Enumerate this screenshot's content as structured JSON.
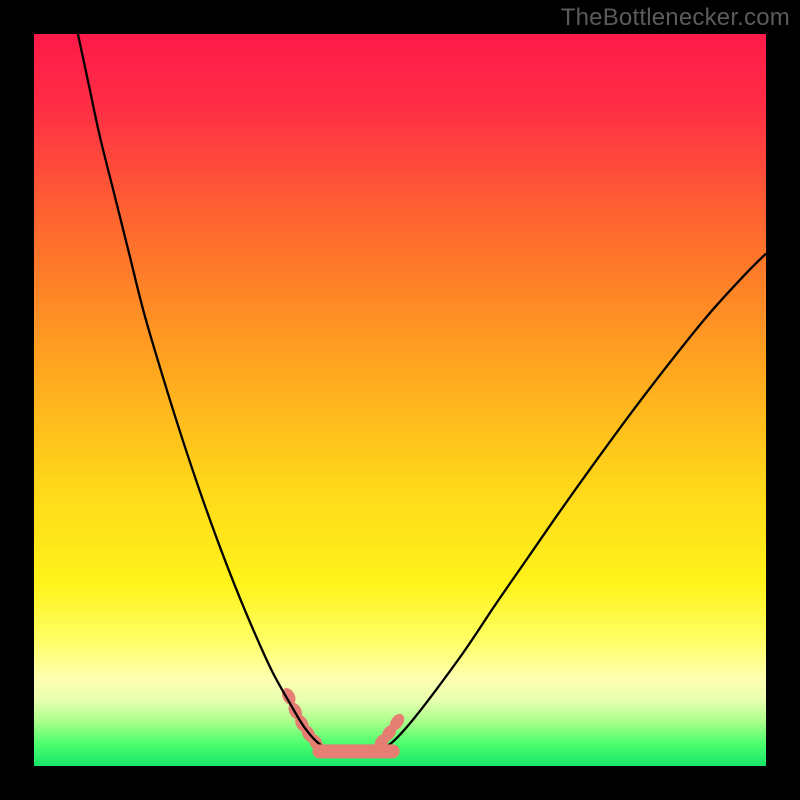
{
  "watermark": "TheBottlenecker.com",
  "chart_data": {
    "type": "line",
    "title": "",
    "xlabel": "",
    "ylabel": "",
    "xlim": [
      0,
      100
    ],
    "ylim": [
      0,
      100
    ],
    "background_gradient_stops": [
      {
        "pos": 0.0,
        "color": "#ff1a49"
      },
      {
        "pos": 0.1,
        "color": "#ff2e45"
      },
      {
        "pos": 0.25,
        "color": "#ff6430"
      },
      {
        "pos": 0.45,
        "color": "#ffa41f"
      },
      {
        "pos": 0.62,
        "color": "#ffd81a"
      },
      {
        "pos": 0.75,
        "color": "#fff31a"
      },
      {
        "pos": 0.83,
        "color": "#ffff66"
      },
      {
        "pos": 0.88,
        "color": "#ffffb0"
      },
      {
        "pos": 0.91,
        "color": "#e8ffb0"
      },
      {
        "pos": 0.94,
        "color": "#a8ff8a"
      },
      {
        "pos": 0.97,
        "color": "#4bff6e"
      },
      {
        "pos": 1.0,
        "color": "#17e668"
      }
    ],
    "series": [
      {
        "name": "left-curve",
        "color": "#000000",
        "width": 2.2,
        "points": [
          {
            "x": 6.0,
            "y": 100.0
          },
          {
            "x": 7.5,
            "y": 93.0
          },
          {
            "x": 9.0,
            "y": 86.0
          },
          {
            "x": 11.0,
            "y": 78.0
          },
          {
            "x": 13.0,
            "y": 70.0
          },
          {
            "x": 15.0,
            "y": 62.0
          },
          {
            "x": 17.5,
            "y": 53.5
          },
          {
            "x": 20.0,
            "y": 45.5
          },
          {
            "x": 22.5,
            "y": 38.0
          },
          {
            "x": 25.0,
            "y": 31.0
          },
          {
            "x": 27.5,
            "y": 24.5
          },
          {
            "x": 30.0,
            "y": 18.5
          },
          {
            "x": 32.5,
            "y": 13.0
          },
          {
            "x": 35.0,
            "y": 8.5
          },
          {
            "x": 37.0,
            "y": 5.2
          },
          {
            "x": 39.0,
            "y": 3.0
          },
          {
            "x": 41.0,
            "y": 2.0
          }
        ]
      },
      {
        "name": "right-curve",
        "color": "#000000",
        "width": 2.2,
        "points": [
          {
            "x": 47.0,
            "y": 2.0
          },
          {
            "x": 49.0,
            "y": 3.3
          },
          {
            "x": 51.5,
            "y": 6.0
          },
          {
            "x": 55.0,
            "y": 10.5
          },
          {
            "x": 59.0,
            "y": 16.0
          },
          {
            "x": 63.0,
            "y": 22.0
          },
          {
            "x": 67.5,
            "y": 28.5
          },
          {
            "x": 72.0,
            "y": 35.0
          },
          {
            "x": 77.0,
            "y": 42.0
          },
          {
            "x": 82.0,
            "y": 48.8
          },
          {
            "x": 87.0,
            "y": 55.3
          },
          {
            "x": 92.0,
            "y": 61.5
          },
          {
            "x": 97.0,
            "y": 67.0
          },
          {
            "x": 100.0,
            "y": 70.0
          }
        ]
      },
      {
        "name": "salmon-flat",
        "color": "#e77e73",
        "width": 12,
        "points": [
          {
            "x": 39.0,
            "y": 2.0
          },
          {
            "x": 41.0,
            "y": 2.0
          },
          {
            "x": 43.0,
            "y": 2.0
          },
          {
            "x": 45.0,
            "y": 2.0
          },
          {
            "x": 47.0,
            "y": 2.0
          },
          {
            "x": 49.0,
            "y": 2.0
          }
        ]
      }
    ],
    "salmon_segments_left": [
      {
        "x": 34.8,
        "y": 9.5
      },
      {
        "x": 35.7,
        "y": 7.5
      },
      {
        "x": 36.6,
        "y": 5.8
      },
      {
        "x": 37.5,
        "y": 4.4
      },
      {
        "x": 38.5,
        "y": 3.2
      }
    ],
    "salmon_segments_right": [
      {
        "x": 47.5,
        "y": 3.3
      },
      {
        "x": 48.5,
        "y": 4.5
      },
      {
        "x": 49.6,
        "y": 6.0
      }
    ]
  }
}
